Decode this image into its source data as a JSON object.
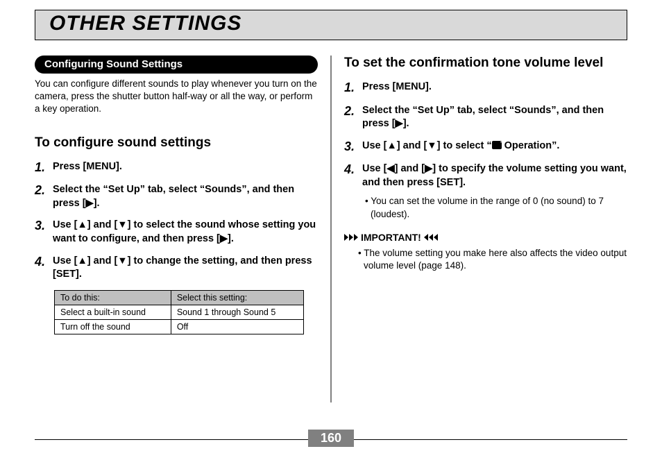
{
  "title": "OTHER SETTINGS",
  "page_number": "160",
  "left": {
    "pill": "Configuring Sound Settings",
    "intro": "You can configure different sounds to play whenever you turn on the camera, press the shutter button half-way or all the way, or perform a key operation.",
    "heading": "To configure sound settings",
    "steps": [
      {
        "num": "1.",
        "txt": "Press [MENU]."
      },
      {
        "num": "2.",
        "txt": "Select the “Set Up” tab, select “Sounds”, and then press [▶]."
      },
      {
        "num": "3.",
        "txt": "Use [▲] and [▼] to select the sound whose setting you want to configure, and then press [▶]."
      },
      {
        "num": "4.",
        "txt": "Use [▲] and [▼] to change the setting, and then press [SET]."
      }
    ],
    "table": {
      "headers": {
        "c1": "To do this:",
        "c2": "Select this setting:"
      },
      "rows": [
        {
          "c1": "Select a built-in sound",
          "c2": "Sound 1 through Sound 5"
        },
        {
          "c1": "Turn off the sound",
          "c2": "Off"
        }
      ]
    }
  },
  "right": {
    "heading": "To set the confirmation tone volume level",
    "steps": [
      {
        "num": "1.",
        "txt": "Press [MENU]."
      },
      {
        "num": "2.",
        "txt": "Select the “Set Up” tab, select “Sounds”, and then press [▶]."
      },
      {
        "num": "3.",
        "txt_pre": "Use [▲] and [▼] to select “",
        "txt_post": " Operation”."
      },
      {
        "num": "4.",
        "txt": "Use [◀] and [▶] to specify the volume setting you want, and then press [SET].",
        "note": "•  You can set the volume in the range of 0 (no sound) to 7 (loudest)."
      }
    ],
    "important": {
      "label": "IMPORTANT!",
      "items": [
        "• The volume setting you make here also affects the video output volume level (page 148)."
      ]
    }
  }
}
